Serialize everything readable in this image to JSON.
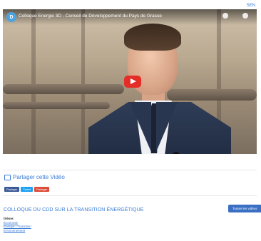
{
  "header": {
    "top_link": "SEN"
  },
  "video": {
    "channel_logo_text": "D",
    "title": "Colloque Energie 3D - Conseil de Développement du Pays de Grasse"
  },
  "share": {
    "title": "Partager cette Vidéo",
    "buttons": [
      "Partager",
      "Tweet",
      "Partager"
    ]
  },
  "section": {
    "heading": "COLLOQUE DU CDD SUR LA TRANSITION ÉNERGÉTIQUE",
    "all_videos_button": "Toutes les vidéos",
    "theme_label": "thème:",
    "theme_links": [
      "Économie",
      "Énergie / Transition",
      "Environnement"
    ]
  },
  "colors": {
    "accent": "#3a7bd5",
    "button": "#3a6fc4",
    "youtube_red": "#e52d27"
  }
}
